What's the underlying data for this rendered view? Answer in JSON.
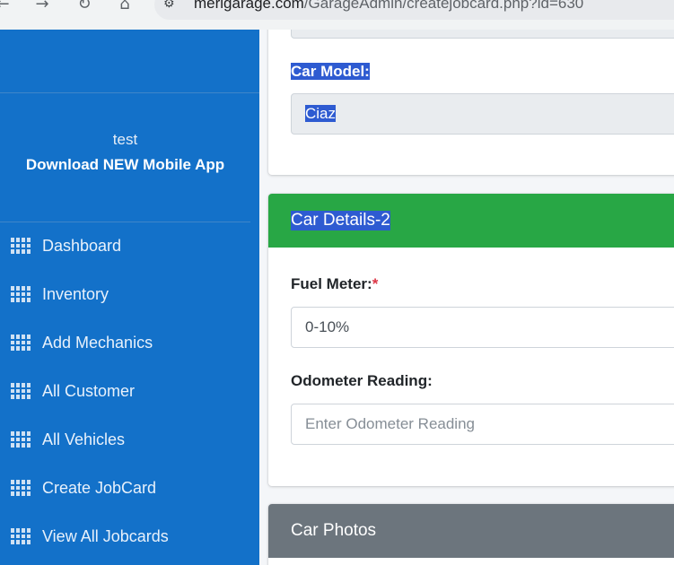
{
  "browser": {
    "url_host": "merigarage.com",
    "url_path": "/GarageAdmin/createjobcard.php?id=630",
    "back_icon": "arrow-left",
    "forward_icon": "arrow-right",
    "reload_icon": "reload",
    "home_icon": "home"
  },
  "sidebar": {
    "user_name": "test",
    "app_link": "Download NEW Mobile App",
    "items": [
      {
        "label": "Dashboard",
        "icon": "grid-icon"
      },
      {
        "label": "Inventory",
        "icon": "grid-icon"
      },
      {
        "label": "Add Mechanics",
        "icon": "grid-icon"
      },
      {
        "label": "All Customer",
        "icon": "grid-icon"
      },
      {
        "label": "All Vehicles",
        "icon": "grid-icon"
      },
      {
        "label": "Create JobCard",
        "icon": "grid-icon"
      },
      {
        "label": "View All Jobcards",
        "icon": "grid-icon"
      }
    ]
  },
  "car_details_1": {
    "car_model_label": "Car Model:",
    "car_model_value": "Ciaz"
  },
  "car_details_2": {
    "header": "Car Details-2",
    "header_color": "#28a745",
    "fuel_label": "Fuel Meter:",
    "fuel_required": "*",
    "fuel_value": "0-10%",
    "odometer_label": "Odometer Reading:",
    "odometer_placeholder": "Enter Odometer Reading"
  },
  "car_photos": {
    "header": "Car Photos",
    "header_color": "#6c757d"
  },
  "colors": {
    "sidebar": "#1371c9",
    "selection": "#2e5bd1"
  }
}
